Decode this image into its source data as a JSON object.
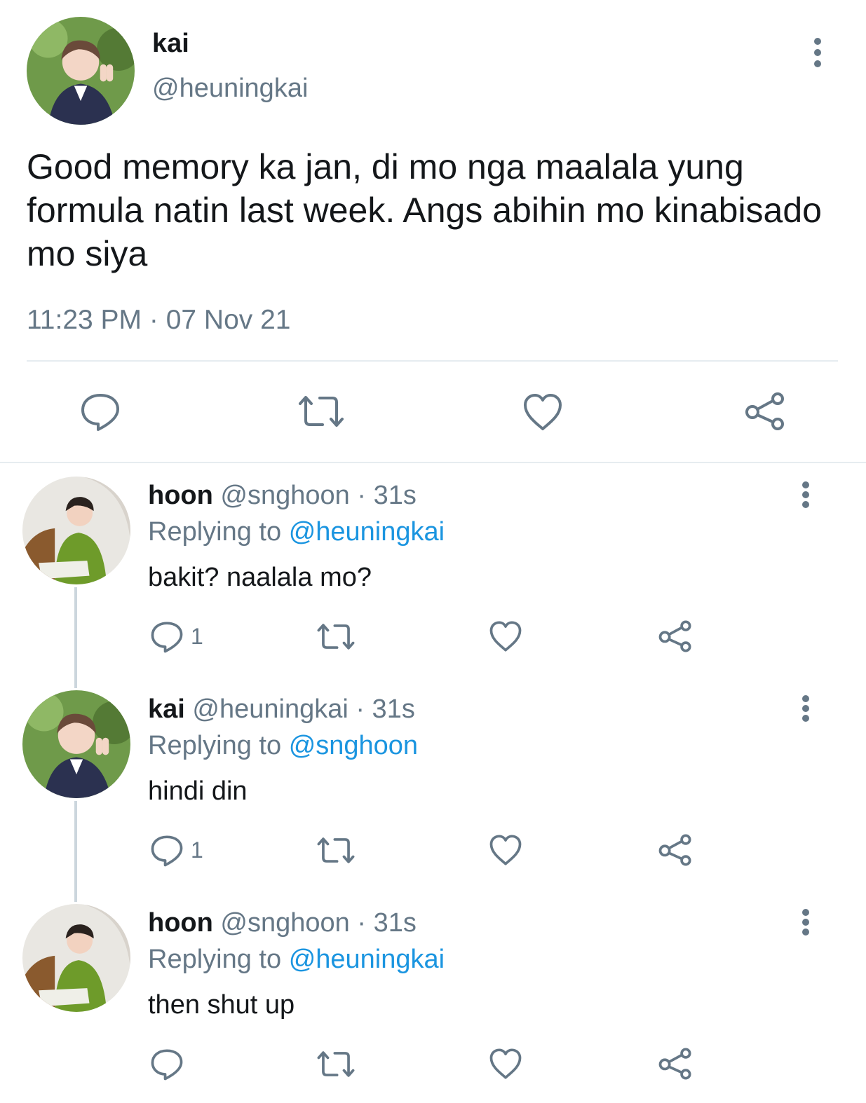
{
  "main_tweet": {
    "name": "kai",
    "handle": "@heuningkai",
    "text": "Good memory ka jan, di mo nga maalala yung formula natin last week. Angs abihin mo kinabisado mo siya",
    "timestamp": "11:23 PM · 07 Nov 21",
    "actions": [
      "reply-icon",
      "retweet-icon",
      "like-icon",
      "share-icon"
    ]
  },
  "replies": [
    {
      "name": "hoon",
      "handle_time": "@snghoon · 31s",
      "replying_prefix": "Replying to",
      "replying_to": "@heuningkai",
      "text": "bakit? naalala mo?",
      "reply_count": "1"
    },
    {
      "name": "kai",
      "handle_time": "@heuningkai · 31s",
      "replying_prefix": "Replying to",
      "replying_to": "@snghoon",
      "text": "hindi din",
      "reply_count": "1"
    },
    {
      "name": "hoon",
      "handle_time": "@snghoon · 31s",
      "replying_prefix": "Replying to",
      "replying_to": "@heuningkai",
      "text": "then shut up",
      "reply_count": ""
    }
  ],
  "colors": {
    "text_primary": "#14171a",
    "text_secondary": "#657786",
    "link": "#1b95e0",
    "divider": "#e6ecf0",
    "icon": "#657786"
  }
}
